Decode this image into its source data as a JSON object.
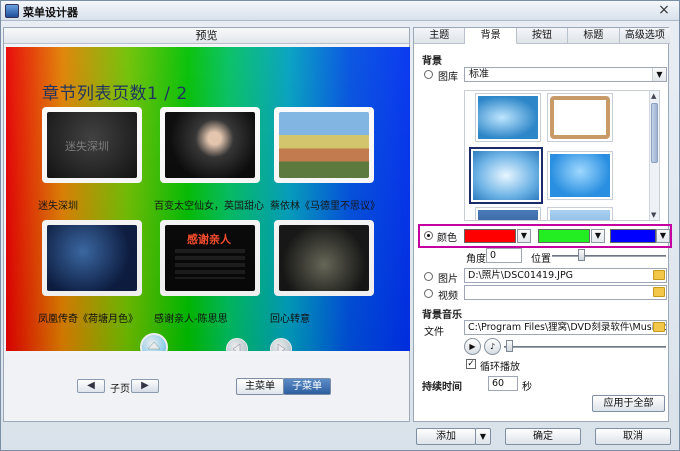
{
  "window": {
    "title": "菜单设计器",
    "close_label": "×"
  },
  "preview": {
    "header": "预览",
    "chapter_title": "章节列表页数1 / 2",
    "thumbnails": [
      {
        "caption": "迷失深圳",
        "overlay": "迷失深圳"
      },
      {
        "caption": "百变太空仙女，英国甜心"
      },
      {
        "caption": "蔡依林《马德里不思议》"
      },
      {
        "caption": "凤凰传奇《荷塘月色》"
      },
      {
        "caption": "感谢亲人-陈思思",
        "overlay": "感谢亲人"
      },
      {
        "caption": "回心转意"
      }
    ],
    "sub_page_label": "子页",
    "prev_label": "◀",
    "next_label": "▶",
    "main_menu_label": "主菜单",
    "sub_menu_label": "子菜单"
  },
  "settings": {
    "tabs": [
      "主题",
      "背景",
      "按钮",
      "标题",
      "高级选项"
    ],
    "active_tab": "背景",
    "section_background": "背景",
    "gallery_label": "图库",
    "gallery_select": "标准",
    "color_label": "颜色",
    "colors": [
      "#ff0000",
      "#22ee22",
      "#0000ff"
    ],
    "angle_label": "角度",
    "angle_value": "0",
    "position_label": "位置",
    "image_label": "图片",
    "image_path": "D:\\照片\\DSC01419.JPG",
    "video_label": "视频",
    "video_path": "",
    "section_music": "背景音乐",
    "file_label": "文件",
    "file_path": "C:\\Program Files\\狸窝\\DVD刻录软件\\Music\\defa",
    "loop_label": "循环播放",
    "duration_label": "持续时间",
    "duration_value": "60",
    "seconds_label": "秒",
    "apply_all_label": "应用于全部"
  },
  "bottom": {
    "add_label": "添加",
    "ok_label": "确定",
    "cancel_label": "取消"
  }
}
